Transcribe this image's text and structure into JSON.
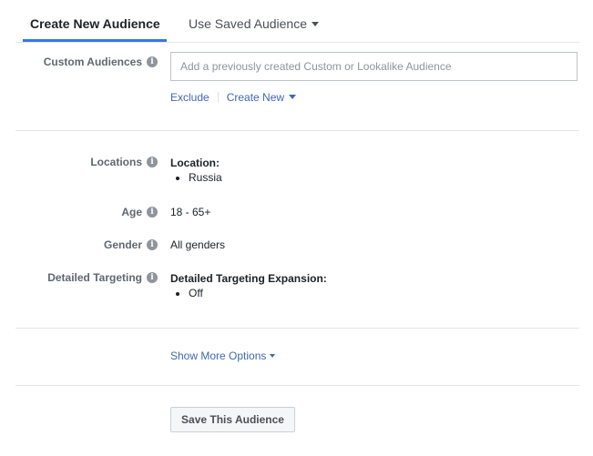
{
  "tabs": {
    "active_label": "Create New Audience",
    "inactive_label": "Use Saved Audience",
    "accent_color": "#3578e5"
  },
  "custom_audiences": {
    "label": "Custom Audiences",
    "input_value": "",
    "placeholder": "Add a previously created Custom or Lookalike Audience",
    "exclude_label": "Exclude",
    "create_new_label": "Create New"
  },
  "locations": {
    "label": "Locations",
    "heading": "Location:",
    "items": [
      "Russia"
    ]
  },
  "age": {
    "label": "Age",
    "value": "18 - 65+"
  },
  "gender": {
    "label": "Gender",
    "value": "All genders"
  },
  "detailed_targeting": {
    "label": "Detailed Targeting",
    "heading": "Detailed Targeting Expansion:",
    "items": [
      "Off"
    ]
  },
  "show_more_label": "Show More Options",
  "save_button_label": "Save This Audience",
  "link_color": "#4267b2"
}
